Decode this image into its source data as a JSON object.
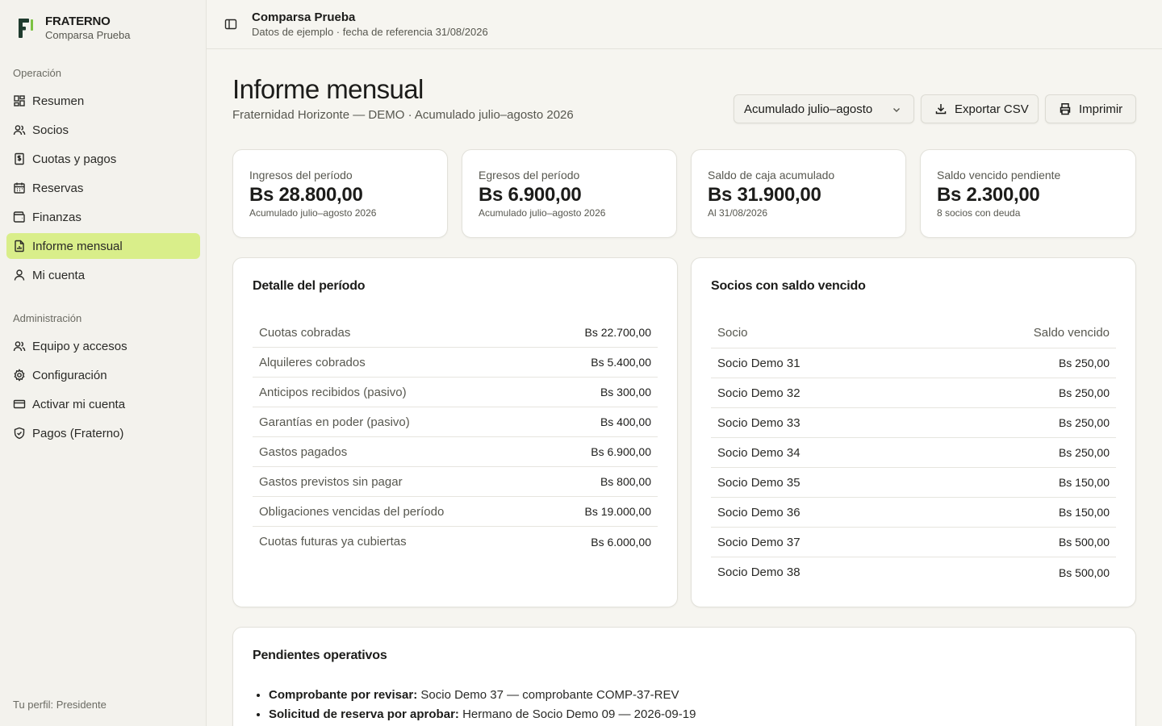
{
  "brand": {
    "name": "FRATERNO",
    "subtitle": "Comparsa Prueba"
  },
  "sidebar": {
    "section1": "Operación",
    "items1": [
      {
        "label": "Resumen",
        "icon": "grid-icon"
      },
      {
        "label": "Socios",
        "icon": "users-icon"
      },
      {
        "label": "Cuotas y pagos",
        "icon": "receipt-icon"
      },
      {
        "label": "Reservas",
        "icon": "calendar-icon"
      },
      {
        "label": "Finanzas",
        "icon": "wallet-icon"
      },
      {
        "label": "Informe mensual",
        "icon": "report-icon",
        "active": true
      },
      {
        "label": "Mi cuenta",
        "icon": "user-icon"
      }
    ],
    "section2": "Administración",
    "items2": [
      {
        "label": "Equipo y accesos",
        "icon": "users-icon"
      },
      {
        "label": "Configuración",
        "icon": "gear-icon"
      },
      {
        "label": "Activar mi cuenta",
        "icon": "card-icon"
      },
      {
        "label": "Pagos (Fraterno)",
        "icon": "shield-icon"
      }
    ],
    "profile": "Tu perfil: Presidente"
  },
  "topbar": {
    "title": "Comparsa Prueba",
    "subtitle": "Datos de ejemplo · fecha de referencia 31/08/2026"
  },
  "header": {
    "title": "Informe mensual",
    "subtitle": "Fraternidad Horizonte — DEMO · Acumulado julio–agosto 2026",
    "period_select": "Acumulado julio–agosto",
    "export_label": "Exportar CSV",
    "print_label": "Imprimir"
  },
  "kpis": [
    {
      "label": "Ingresos del período",
      "value": "Bs 28.800,00",
      "sub": "Acumulado julio–agosto 2026"
    },
    {
      "label": "Egresos del período",
      "value": "Bs 6.900,00",
      "sub": "Acumulado julio–agosto 2026"
    },
    {
      "label": "Saldo de caja acumulado",
      "value": "Bs 31.900,00",
      "sub": "Al 31/08/2026"
    },
    {
      "label": "Saldo vencido pendiente",
      "value": "Bs 2.300,00",
      "sub": "8 socios con deuda"
    }
  ],
  "detalle": {
    "title": "Detalle del período",
    "rows": [
      {
        "k": "Cuotas cobradas",
        "v": "Bs 22.700,00"
      },
      {
        "k": "Alquileres cobrados",
        "v": "Bs 5.400,00"
      },
      {
        "k": "Anticipos recibidos (pasivo)",
        "v": "Bs 300,00"
      },
      {
        "k": "Garantías en poder (pasivo)",
        "v": "Bs 400,00"
      },
      {
        "k": "Gastos pagados",
        "v": "Bs 6.900,00"
      },
      {
        "k": "Gastos previstos sin pagar",
        "v": "Bs 800,00"
      },
      {
        "k": "Obligaciones vencidas del período",
        "v": "Bs 19.000,00"
      },
      {
        "k": "Cuotas futuras ya cubiertas",
        "v": "Bs 6.000,00"
      }
    ]
  },
  "socios": {
    "title": "Socios con saldo vencido",
    "col_socio": "Socio",
    "col_saldo": "Saldo vencido",
    "rows": [
      {
        "name": "Socio Demo 31",
        "amount": "Bs 250,00"
      },
      {
        "name": "Socio Demo 32",
        "amount": "Bs 250,00"
      },
      {
        "name": "Socio Demo 33",
        "amount": "Bs 250,00"
      },
      {
        "name": "Socio Demo 34",
        "amount": "Bs 250,00"
      },
      {
        "name": "Socio Demo 35",
        "amount": "Bs 150,00"
      },
      {
        "name": "Socio Demo 36",
        "amount": "Bs 150,00"
      },
      {
        "name": "Socio Demo 37",
        "amount": "Bs 500,00"
      },
      {
        "name": "Socio Demo 38",
        "amount": "Bs 500,00"
      }
    ]
  },
  "pendientes": {
    "title": "Pendientes operativos",
    "items": [
      {
        "label": "Comprobante por revisar:",
        "detail": "Socio Demo 37 — comprobante COMP-37-REV"
      },
      {
        "label": "Solicitud de reserva por aprobar:",
        "detail": "Hermano de Socio Demo 09 — 2026-09-19"
      }
    ]
  },
  "colors": {
    "active_nav": "#d9ee8a",
    "logo_dark": "#1f3b2e",
    "logo_accent": "#7cc242"
  }
}
